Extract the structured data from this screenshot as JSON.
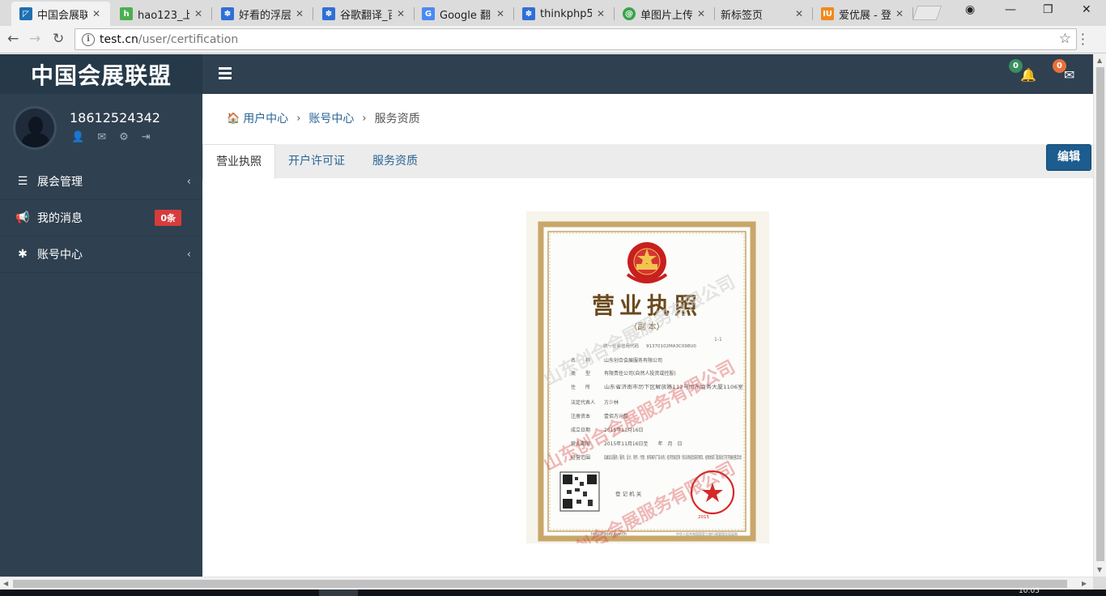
{
  "browser": {
    "tabs": [
      {
        "title": "中国会展联",
        "active": true,
        "favicon": "app-logo-icon",
        "color": "#1f6fb2"
      },
      {
        "title": "hao123_上",
        "active": false,
        "favicon": "hao123-icon",
        "color": "#4caf50"
      },
      {
        "title": "好看的浮层",
        "active": false,
        "favicon": "baidu-paw-icon",
        "color": "#2f6fd8"
      },
      {
        "title": "谷歌翻译_百",
        "active": false,
        "favicon": "baidu-paw-icon",
        "color": "#2f6fd8"
      },
      {
        "title": "Google 翻",
        "active": false,
        "favicon": "google-translate-icon",
        "color": "#4a8af4"
      },
      {
        "title": "thinkphp5",
        "active": false,
        "favicon": "baidu-paw-icon",
        "color": "#2f6fd8"
      },
      {
        "title": "单图片上传",
        "active": false,
        "favicon": "spiral-icon",
        "color": "#3aa34b"
      },
      {
        "title": "新标签页",
        "active": false,
        "favicon": "",
        "color": ""
      },
      {
        "title": "爱优展 - 登",
        "active": false,
        "favicon": "iu-icon",
        "color": "#f08a1c"
      }
    ],
    "url_host": "test.cn",
    "url_path": "/user/certification",
    "clock": "10:05"
  },
  "app": {
    "logo": "中国会展联盟",
    "user": {
      "phone": "18612524342"
    },
    "sidebar": {
      "items": [
        {
          "label": "展会管理",
          "icon": "list-icon",
          "has_arrow": true,
          "badge": ""
        },
        {
          "label": "我的消息",
          "icon": "bullhorn-icon",
          "has_arrow": false,
          "badge": "0条"
        },
        {
          "label": "账号中心",
          "icon": "gear-icon",
          "has_arrow": true,
          "badge": ""
        }
      ]
    },
    "topbar": {
      "bell_count": "0",
      "mail_count": "0"
    },
    "breadcrumb": {
      "home": "用户中心",
      "level2": "账号中心",
      "current": "服务资质"
    },
    "tabs": [
      "营业执照",
      "开户许可证",
      "服务资质"
    ],
    "active_tab": 0,
    "edit_label": "编辑"
  },
  "certificate": {
    "title": "营业执照",
    "subtitle": "（副 本）",
    "page_no": "1-1",
    "credit_code_label": "统一社会信用代码",
    "credit_code": "91370102MA3C098U0",
    "watermark": "山东创合会展服务有限公司",
    "fields": [
      {
        "label": "名　　称",
        "value": "山东创合会展服务有限公司"
      },
      {
        "label": "类　　型",
        "value": "有限责任公司(自然人投资或控股)"
      },
      {
        "label": "住　　所",
        "value": "山东省济南市历下区解放路112号历东商务大厦1106室"
      },
      {
        "label": "法定代表人",
        "value": "方少林"
      },
      {
        "label": "注册资本",
        "value": "壹佰万元整"
      },
      {
        "label": "成立日期",
        "value": "2015年11月16日"
      },
      {
        "label": "营业期限",
        "value": "2015年11月16日至　　年　月　日"
      },
      {
        "label": "经营范围",
        "value": "会展会议服务；服务；设计、制作、代理、发布国内广告业务；经济贸易咨询（依法须经批准的项目，经相关部门批准后方可开展经营活动）"
      }
    ],
    "registration_label": "登 记 机 关",
    "issue_year": "2015",
    "website": "http://sdxy.gov.cn",
    "footer_note": "中华人民共和国国家工商行政管理总局监制"
  },
  "colors": {
    "sidebar_bg": "#2f4050",
    "logo_bg": "#263949",
    "link": "#2a6496",
    "edit_button": "#1c5c8e",
    "badge_red": "#d63c3c",
    "notif_green": "#3a8e5f",
    "notif_orange": "#e8703a"
  }
}
